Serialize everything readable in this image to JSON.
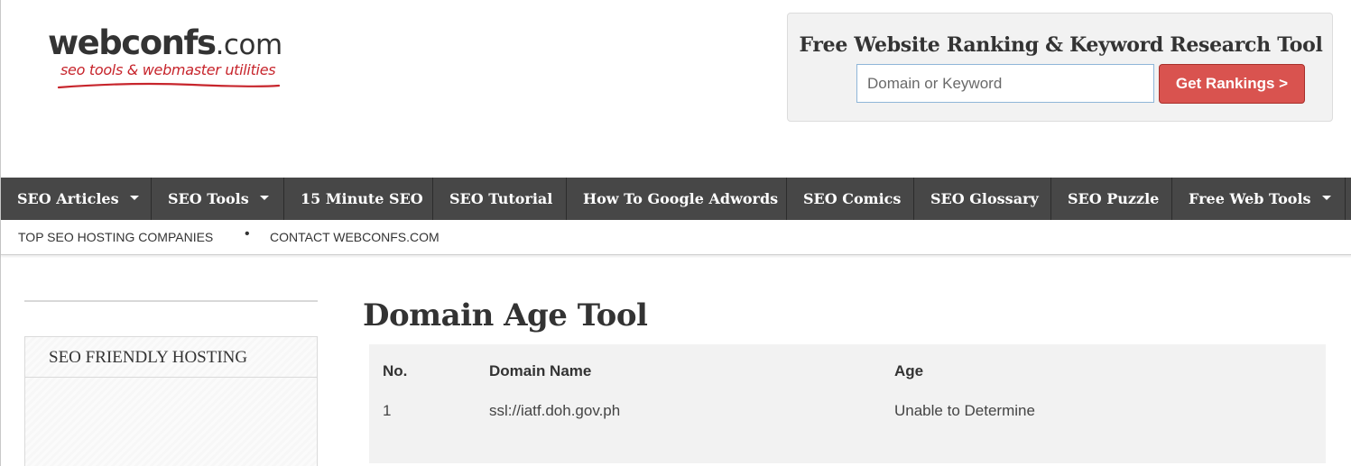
{
  "brand": {
    "name": "webconfs",
    "suffix": ".com",
    "tagline": "seo tools & webmaster utilities",
    "accent": "#c7252c"
  },
  "research_tool": {
    "title": "Free Website Ranking & Keyword Research Tool",
    "input_placeholder": "Domain or Keyword",
    "input_value": "",
    "button_label": "Get Rankings >",
    "button_color": "#d9534f"
  },
  "nav": {
    "items": [
      {
        "label": "SEO Articles",
        "dropdown": true
      },
      {
        "label": "SEO Tools",
        "dropdown": true
      },
      {
        "label": "15 Minute SEO",
        "dropdown": false
      },
      {
        "label": "SEO Tutorial",
        "dropdown": false
      },
      {
        "label": "How To Google Adwords",
        "dropdown": false
      },
      {
        "label": "SEO Comics",
        "dropdown": false
      },
      {
        "label": "SEO Glossary",
        "dropdown": false
      },
      {
        "label": "SEO Puzzle",
        "dropdown": false
      },
      {
        "label": "Free Web Tools",
        "dropdown": true
      }
    ],
    "background": "#474747"
  },
  "subnav": {
    "links": [
      "TOP SEO HOSTING COMPANIES",
      "CONTACT WEBCONFS.COM"
    ],
    "separator": "•"
  },
  "sidebar": {
    "panel_title": "SEO FRIENDLY HOSTING"
  },
  "main": {
    "title": "Domain Age Tool",
    "table": {
      "headers": [
        "No.",
        "Domain Name",
        "Age"
      ],
      "rows": [
        [
          "1",
          "ssl://iatf.doh.gov.ph",
          "Unable to Determine"
        ]
      ]
    }
  }
}
